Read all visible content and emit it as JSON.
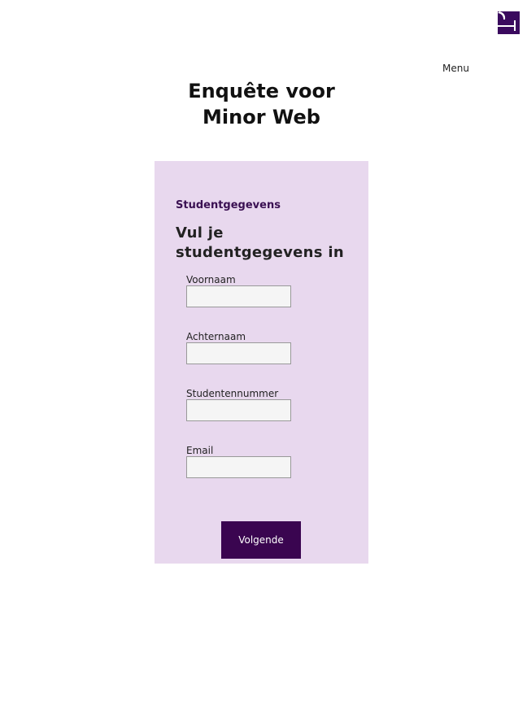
{
  "header": {
    "menu_label": "Menu",
    "title_line1": "Enquête voor",
    "title_line2": "Minor Web",
    "brand_color": "#3a0a5e"
  },
  "form": {
    "legend": "Studentgegevens",
    "heading_line1": "Vul je",
    "heading_line2": "studentgegevens in",
    "fields": [
      {
        "label": "Voornaam",
        "value": ""
      },
      {
        "label": "Achternaam",
        "value": ""
      },
      {
        "label": "Studentennummer",
        "value": ""
      },
      {
        "label": "Email",
        "value": ""
      }
    ],
    "submit_label": "Volgende"
  }
}
